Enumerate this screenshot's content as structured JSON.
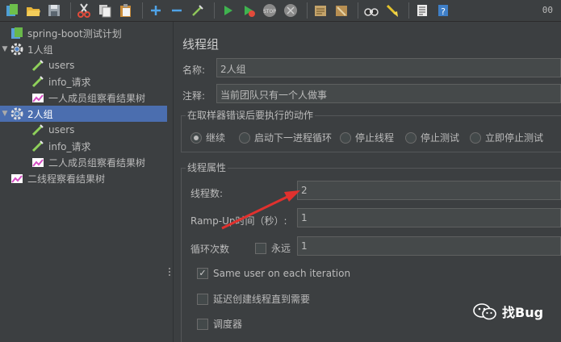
{
  "toolbar": {
    "buttons": [
      "new-icon",
      "open-icon",
      "save-icon",
      "cut-icon",
      "copy-icon",
      "paste-icon",
      "expand-icon",
      "collapse-icon",
      "toggle-icon",
      "start-icon",
      "start-no-pause-icon",
      "stop-icon",
      "shutdown-icon",
      "settings-icon",
      "clear-icon",
      "search-icon",
      "clear-all-icon",
      "function-helper-icon",
      "help-icon"
    ],
    "time": "00"
  },
  "tree": {
    "items": [
      {
        "label": "spring-boot测试计划",
        "level": 0,
        "icon": "test-plan-icon",
        "selected": false,
        "toggle": ""
      },
      {
        "label": "1人组",
        "level": 0,
        "icon": "gear-icon",
        "selected": false,
        "toggle": "▼"
      },
      {
        "label": "users",
        "level": 1,
        "icon": "pipette-icon",
        "selected": false,
        "toggle": ""
      },
      {
        "label": "info_请求",
        "level": 1,
        "icon": "pipette-icon",
        "selected": false,
        "toggle": ""
      },
      {
        "label": "一人成员组察看结果树",
        "level": 1,
        "icon": "chart-icon",
        "selected": false,
        "toggle": ""
      },
      {
        "label": "2人组",
        "level": 0,
        "icon": "gear-icon",
        "selected": true,
        "toggle": "▼"
      },
      {
        "label": "users",
        "level": 1,
        "icon": "pipette-icon",
        "selected": false,
        "toggle": ""
      },
      {
        "label": "info_请求",
        "level": 1,
        "icon": "pipette-icon",
        "selected": false,
        "toggle": ""
      },
      {
        "label": "二人成员组察看结果树",
        "level": 1,
        "icon": "chart-icon",
        "selected": false,
        "toggle": ""
      },
      {
        "label": "二线程察看结果树",
        "level": 0,
        "icon": "chart-icon",
        "selected": false,
        "toggle": ""
      }
    ]
  },
  "panel": {
    "title": "线程组",
    "name_label": "名称:",
    "name_value": "2人组",
    "comment_label": "注释:",
    "comment_value": "当前团队只有一个人做事",
    "error_group_title": "在取样器错误后要执行的动作",
    "error_options": [
      "继续",
      "启动下一进程循环",
      "停止线程",
      "停止测试",
      "立即停止测试"
    ],
    "error_selected": 0,
    "props_title": "线程属性",
    "threads_label": "线程数:",
    "threads_value": "2",
    "rampup_label": "Ramp-Up时间（秒）:",
    "rampup_value": "1",
    "loop_label": "循环次数",
    "forever_label": "永远",
    "forever_checked": false,
    "loop_value": "1",
    "same_user_label": "Same user on each iteration",
    "same_user_checked": true,
    "delay_label": "延迟创建线程直到需要",
    "delay_checked": false,
    "scheduler_label": "调度器",
    "scheduler_checked": false
  },
  "watermark": {
    "text": "找Bug",
    "icon": "wechat-icon"
  },
  "colors": {
    "selection": "#4b6eaf",
    "arrow": "#e0312e",
    "background": "#3c3f41"
  }
}
